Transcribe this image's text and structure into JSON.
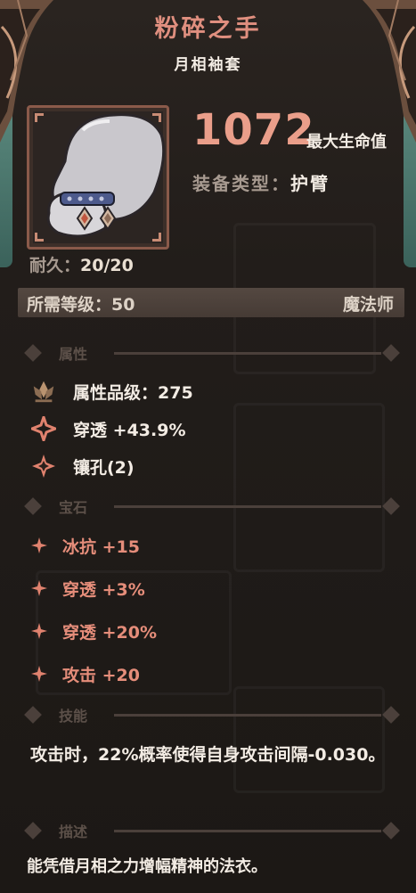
{
  "item": {
    "name": "粉碎之手",
    "subtitle": "月相袖套",
    "main_stat_value": "1072",
    "main_stat_name": "最大生命值",
    "equip_type_label": "装备类型：",
    "equip_type_value": "护臂",
    "durability_label": "耐久：",
    "durability_value": "20/20",
    "required_level_label": "所需等级：",
    "required_level_value": "50",
    "class": "魔法师"
  },
  "sections": {
    "attributes": "属性",
    "gems": "宝石",
    "skill": "技能",
    "description": "描述"
  },
  "attributes": [
    {
      "label": "属性品级：",
      "value": "275",
      "icon": "lotus-icon"
    },
    {
      "label": "穿透",
      "value": "+43.9%",
      "icon": "burst-icon"
    },
    {
      "label": "镶孔(2)",
      "value": "",
      "icon": "socket-icon"
    }
  ],
  "gems": [
    {
      "label": "冰抗",
      "value": "+15"
    },
    {
      "label": "穿透",
      "value": "+3%"
    },
    {
      "label": "穿透",
      "value": "+20%"
    },
    {
      "label": "攻击",
      "value": "+20"
    }
  ],
  "skill_text": "攻击时，22%概率使得自身攻击间隔-0.030。",
  "description_text": "能凭借月相之力增幅精神的法衣。",
  "colors": {
    "title": "#e08f7f",
    "highlight": "#ea9e8a",
    "gem_text": "#e58d7a",
    "accent_teal": "#6ea89a"
  }
}
